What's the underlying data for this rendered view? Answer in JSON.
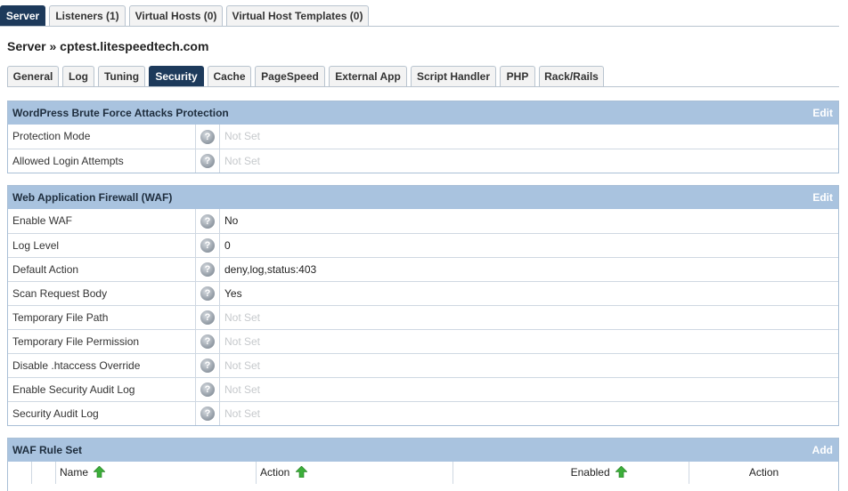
{
  "top_tabs": [
    {
      "label": "Server",
      "active": true
    },
    {
      "label": "Listeners (1)",
      "active": false
    },
    {
      "label": "Virtual Hosts (0)",
      "active": false
    },
    {
      "label": "Virtual Host Templates (0)",
      "active": false
    }
  ],
  "breadcrumb": "Server » cptest.litespeedtech.com",
  "sub_tabs": [
    {
      "label": "General"
    },
    {
      "label": "Log"
    },
    {
      "label": "Tuning"
    },
    {
      "label": "Security",
      "active": true
    },
    {
      "label": "Cache"
    },
    {
      "label": "PageSpeed"
    },
    {
      "label": "External App"
    },
    {
      "label": "Script Handler"
    },
    {
      "label": "PHP"
    },
    {
      "label": "Rack/Rails"
    }
  ],
  "icons": {
    "help": "help-question-icon",
    "sort": "sort-ascending-arrow-icon"
  },
  "colors": {
    "active_tab": "#1d3a5b",
    "panel_header": "#a9c3df",
    "not_set": "#c6c9cc",
    "sort_arrow": "#3cae3a"
  },
  "brute_force": {
    "title": "WordPress Brute Force Attacks Protection",
    "action": "Edit",
    "rows": [
      {
        "label": "Protection Mode",
        "value": "Not Set",
        "notset": true
      },
      {
        "label": "Allowed Login Attempts",
        "value": "Not Set",
        "notset": true
      }
    ]
  },
  "waf": {
    "title": "Web Application Firewall (WAF)",
    "action": "Edit",
    "rows": [
      {
        "label": "Enable WAF",
        "value": "No",
        "notset": false
      },
      {
        "label": "Log Level",
        "value": "0",
        "notset": false
      },
      {
        "label": "Default Action",
        "value": "deny,log,status:403",
        "notset": false
      },
      {
        "label": "Scan Request Body",
        "value": "Yes",
        "notset": false
      },
      {
        "label": "Temporary File Path",
        "value": "Not Set",
        "notset": true
      },
      {
        "label": "Temporary File Permission",
        "value": "Not Set",
        "notset": true
      },
      {
        "label": "Disable .htaccess Override",
        "value": "Not Set",
        "notset": true
      },
      {
        "label": "Enable Security Audit Log",
        "value": "Not Set",
        "notset": true
      },
      {
        "label": "Security Audit Log",
        "value": "Not Set",
        "notset": true
      }
    ]
  },
  "waf_rule_set": {
    "title": "WAF Rule Set",
    "action": "Add",
    "columns": [
      "Name",
      "Action",
      "Enabled",
      "Action"
    ]
  }
}
